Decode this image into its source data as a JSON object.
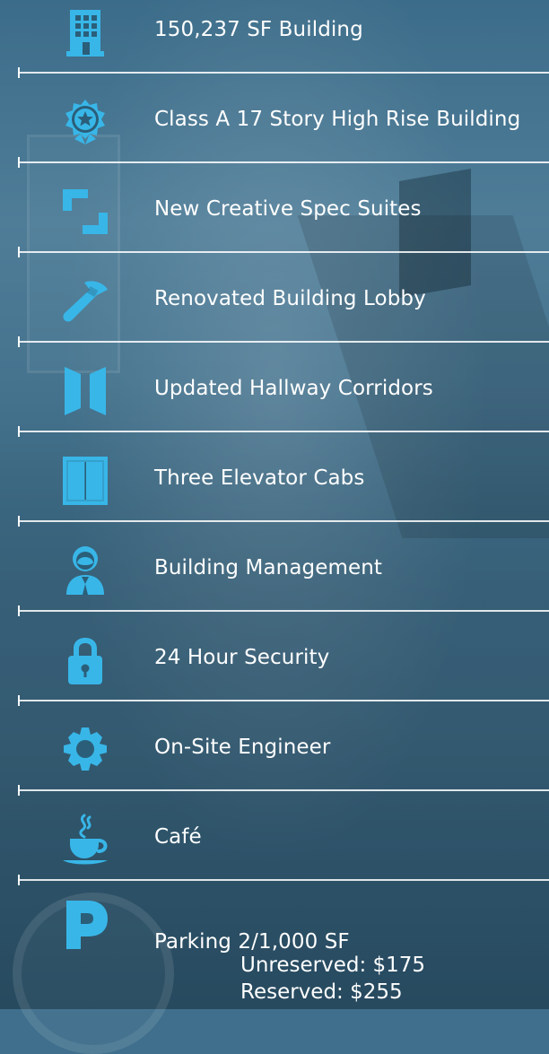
{
  "colors": {
    "accent": "#38b6e8",
    "text": "#ffffff"
  },
  "features": [
    {
      "icon": "building-icon",
      "label": "150,237 SF Building"
    },
    {
      "icon": "badge-star-icon",
      "label": "Class A 17 Story High Rise Building"
    },
    {
      "icon": "frame-corners-icon",
      "label": "New Creative Spec Suites"
    },
    {
      "icon": "hammer-icon",
      "label": "Renovated Building Lobby"
    },
    {
      "icon": "hallway-icon",
      "label": "Updated Hallway Corridors"
    },
    {
      "icon": "elevator-icon",
      "label": "Three Elevator Cabs"
    },
    {
      "icon": "manager-icon",
      "label": "Building Management"
    },
    {
      "icon": "lock-icon",
      "label": "24 Hour Security"
    },
    {
      "icon": "gear-icon",
      "label": "On-Site Engineer"
    },
    {
      "icon": "coffee-icon",
      "label": "Café"
    },
    {
      "icon": "parking-icon",
      "label": "Parking 2/1,000 SF"
    }
  ],
  "parking": {
    "unreserved": "Unreserved: $175",
    "reserved": "Reserved: $255"
  }
}
